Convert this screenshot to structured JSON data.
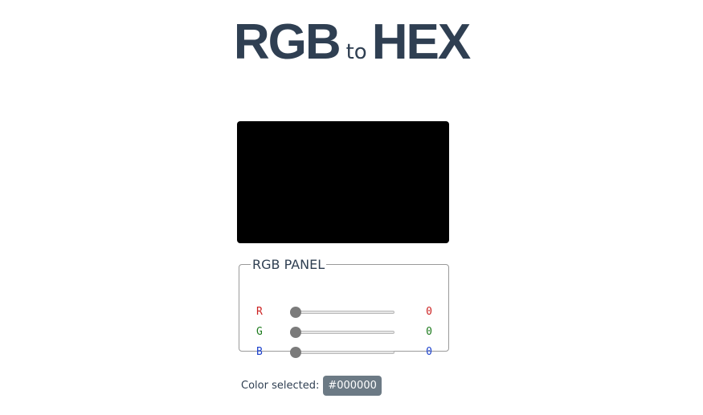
{
  "header": {
    "left": "RGB",
    "connector": "to",
    "right": "HEX"
  },
  "preview": {
    "color": "#000000"
  },
  "panel": {
    "legend": "RGB PANEL",
    "max": 255,
    "channels": [
      {
        "label": "R",
        "value": 0,
        "display": "0",
        "color": "#cc2222"
      },
      {
        "label": "G",
        "value": 0,
        "display": "0",
        "color": "#1c7a1c"
      },
      {
        "label": "B",
        "value": 0,
        "display": "0",
        "color": "#1a3fcc"
      }
    ]
  },
  "result": {
    "caption": "Color selected:",
    "hex": "#000000"
  }
}
